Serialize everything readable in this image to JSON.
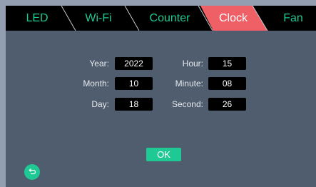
{
  "tabs": [
    {
      "label": "LED",
      "active": false
    },
    {
      "label": "Wi-Fi",
      "active": false
    },
    {
      "label": "Counter",
      "active": false
    },
    {
      "label": "Clock",
      "active": true
    },
    {
      "label": "Fan",
      "active": false
    }
  ],
  "clock_form": {
    "year": {
      "label": "Year:",
      "value": "2022"
    },
    "month": {
      "label": "Month:",
      "value": "10"
    },
    "day": {
      "label": "Day:",
      "value": "18"
    },
    "hour": {
      "label": "Hour:",
      "value": "15"
    },
    "minute": {
      "label": "Minute:",
      "value": "08"
    },
    "second": {
      "label": "Second:",
      "value": "26"
    }
  },
  "ok_button": {
    "label": "OK"
  },
  "back_button": {
    "icon": "back-arrow-icon"
  },
  "colors": {
    "page_background": "#939eb1",
    "screen_background": "#4f5d6e",
    "tabbar_background": "#000000",
    "accent": "#1ec993",
    "active_tab": "#ee6065",
    "separator": "#c5c9d0"
  }
}
